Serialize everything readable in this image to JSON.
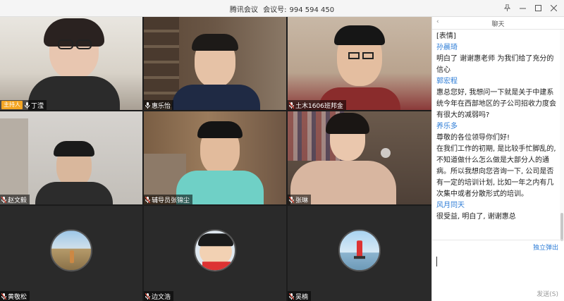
{
  "window": {
    "app_name": "腾讯会议",
    "meeting_id_label": "会议号:",
    "meeting_id": "994 594 450",
    "buttons": [
      "pin",
      "minimize",
      "maximize",
      "close"
    ]
  },
  "participants": [
    {
      "name": "丁滢",
      "host_badge": "主持人",
      "mic": "on"
    },
    {
      "name": "惠乐怡",
      "mic": "on"
    },
    {
      "name": "土木1606班邦金",
      "mic": "muted"
    },
    {
      "name": "赵文毅",
      "mic": "muted"
    },
    {
      "name": "辅导员张锦尘",
      "mic": "muted"
    },
    {
      "name": "张琳",
      "mic": "muted"
    },
    {
      "name": "黄敬松",
      "mic": "muted"
    },
    {
      "name": "边文浩",
      "mic": "muted"
    },
    {
      "name": "吴楠",
      "mic": "muted"
    }
  ],
  "chat": {
    "title": "聊天",
    "messages": [
      {
        "sender": "",
        "text": "[表情]"
      },
      {
        "sender": "孙晨琦",
        "text": "明白了 谢谢惠老师 为我们给了充分的信心"
      },
      {
        "sender": "郭宏程",
        "text": "惠总您好, 我想问一下就是关于中建系统今年在西部地区的子公司招收力度会有很大的减弱吗?"
      },
      {
        "sender": "养乐多",
        "text": "尊敬的各位领导你们好!\n在我们工作的初期, 是比较手忙脚乱的, 不知道做什么怎么做是大部分人的通病。所以我想向您咨询一下, 公司是否有一定的培训计划, 比如一年之内有几次集中或者分散形式的培训。"
      },
      {
        "sender": "风月同天",
        "text": "很受益, 明白了, 谢谢惠总"
      }
    ],
    "popout_label": "独立弹出",
    "send_label": "发送(S)"
  },
  "colors": {
    "host_badge": "#f5a623",
    "sender_name": "#2b7bd6",
    "grid_bg": "#1c1c1c"
  }
}
